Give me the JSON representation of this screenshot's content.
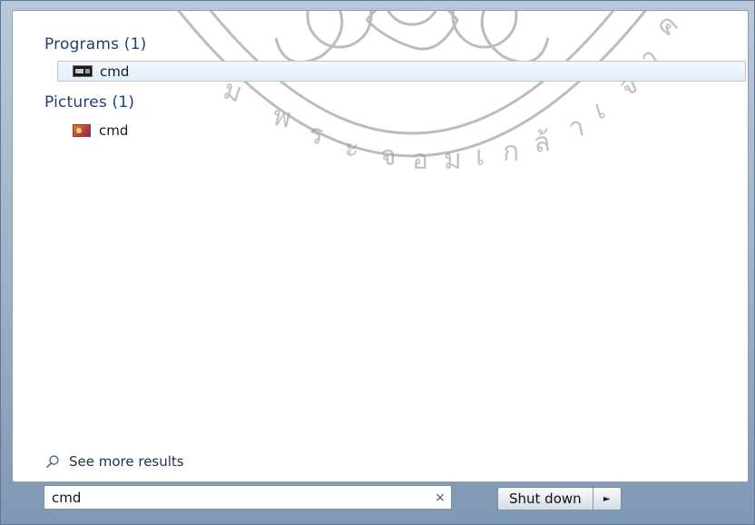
{
  "programs": {
    "header": "Programs (1)",
    "items": [
      {
        "label": "cmd",
        "icon": "cmd-icon"
      }
    ]
  },
  "pictures": {
    "header": "Pictures (1)",
    "items": [
      {
        "label": "cmd",
        "icon": "picture-icon"
      }
    ]
  },
  "see_more": {
    "label": "See more results",
    "icon": "search-icon"
  },
  "search": {
    "value": "cmd",
    "clear_icon": "close-icon",
    "clear_glyph": "×"
  },
  "shutdown": {
    "label": "Shut down",
    "arrow_glyph": "►"
  },
  "colors": {
    "header_text": "#1e3f78",
    "selection_border": "#a9cbe9",
    "watermark": "#9a9a9a"
  }
}
